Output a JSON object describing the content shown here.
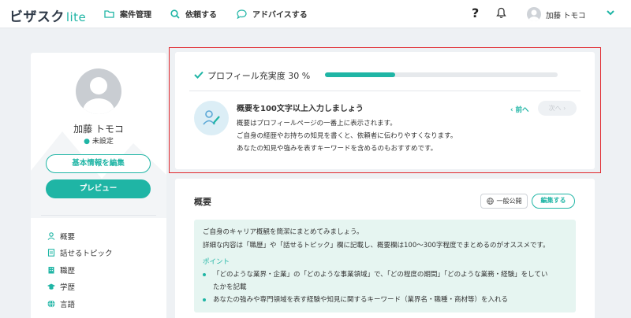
{
  "header": {
    "logo_main": "ビザスク",
    "logo_sub": "lite",
    "nav": [
      {
        "label": "案件管理",
        "icon": "folder-icon"
      },
      {
        "label": "依頼する",
        "icon": "search-icon"
      },
      {
        "label": "アドバイスする",
        "icon": "chat-bubble-icon"
      }
    ],
    "help_label": "?",
    "user_name": "加藤 トモコ"
  },
  "profile": {
    "name": "加藤 トモコ",
    "location": "未設定",
    "edit_button": "基本情報を編集",
    "preview_button": "プレビュー",
    "menu": [
      {
        "label": "概要",
        "icon": "person-icon"
      },
      {
        "label": "話せるトピック",
        "icon": "document-icon"
      },
      {
        "label": "職歴",
        "icon": "building-icon"
      },
      {
        "label": "学歴",
        "icon": "graduation-cap-icon"
      },
      {
        "label": "言語",
        "icon": "globe-icon"
      }
    ]
  },
  "progress": {
    "label": "プロフィール充実度 30 %",
    "percent": 30,
    "tip_title": "概要を100文字以上入力しましょう",
    "tip_lines": [
      "概要はプロフィールページの一番上に表示されます。",
      "ご自身の経歴やお持ちの知見を書くと、依頼者に伝わりやすくなります。",
      "あなたの知見や強みを表すキーワードを含めるのもおすすめです。"
    ],
    "prev_label": "‹ 前へ",
    "next_label": "次へ ›"
  },
  "overview": {
    "title": "概要",
    "visibility_label": "一般公開",
    "edit_label": "編集する",
    "guide_lines": [
      "ご自身のキャリア概観を簡潔にまとめてみましょう。",
      "詳細な内容は「職歴」や「話せるトピック」欄に記載し、概要欄は100〜300字程度でまとめるのがオススメです。"
    ],
    "point_label": "ポイント",
    "bullets": [
      "「どのような業界・企業」の「どのような事業領域」で、「どの程度の期間」「どのような業務・経験」をしてい",
      "たかを記載",
      "あなたの強みや専門領域を表す経験や知見に関するキーワード（業界名・職種・商材等）を入れる"
    ]
  },
  "colors": {
    "accent": "#1fb5a5",
    "highlight_border": "#e0262b",
    "background": "#eef1f4"
  }
}
